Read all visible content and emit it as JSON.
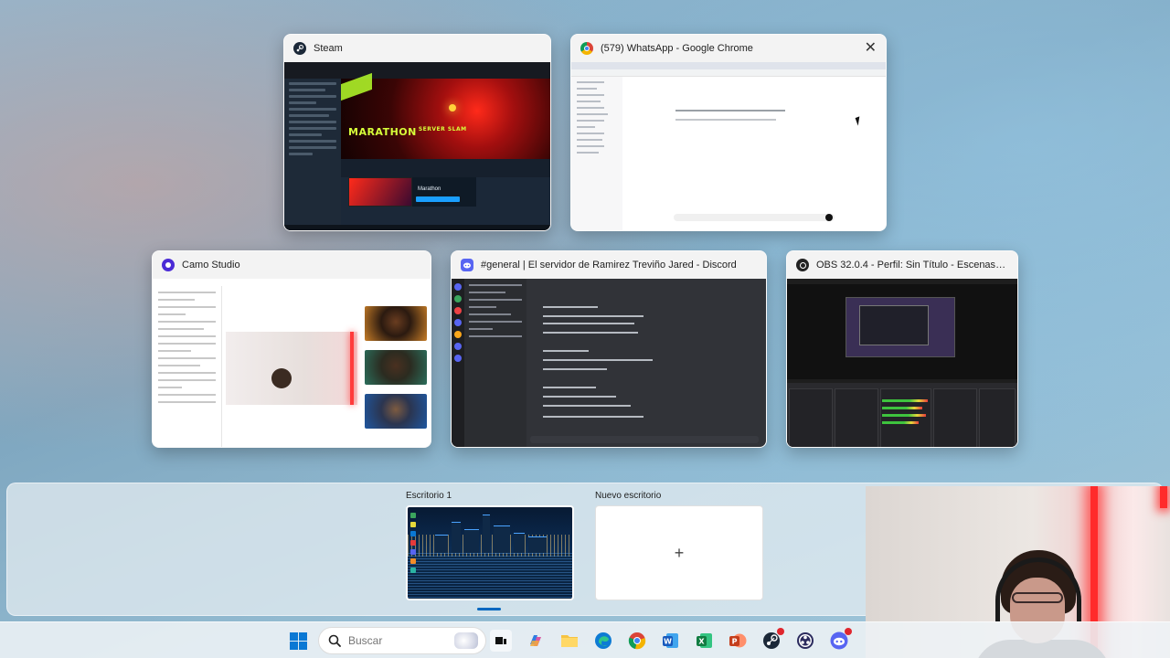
{
  "windows": [
    {
      "id": "steam",
      "title": "Steam"
    },
    {
      "id": "chrome",
      "title": "(579) WhatsApp - Google Chrome"
    },
    {
      "id": "camo",
      "title": "Camo Studio"
    },
    {
      "id": "discord",
      "title": "#general | El servidor de Ramirez Treviño Jared - Discord"
    },
    {
      "id": "obs",
      "title": "OBS 32.0.4 - Perfil: Sin Título - Escenas: Sin Tít..."
    }
  ],
  "steam_preview": {
    "logo_line1": "MARATHON",
    "logo_line2": "SERVER SLAM",
    "game_name": "Marathon"
  },
  "desktops": {
    "desktop1_label": "Escritorio 1",
    "new_desktop_label": "Nuevo escritorio",
    "plus_glyph": "+"
  },
  "taskbar": {
    "search_placeholder": "Buscar",
    "items": [
      "start",
      "search",
      "task-view",
      "copilot",
      "file-explorer",
      "edge",
      "chrome",
      "word",
      "excel",
      "powerpoint",
      "steam",
      "obs",
      "discord"
    ]
  },
  "colors": {
    "accent": "#0067c0",
    "windows_blue": "#0a78d4",
    "discord": "#5865f2",
    "steam_dark": "#171a21"
  }
}
